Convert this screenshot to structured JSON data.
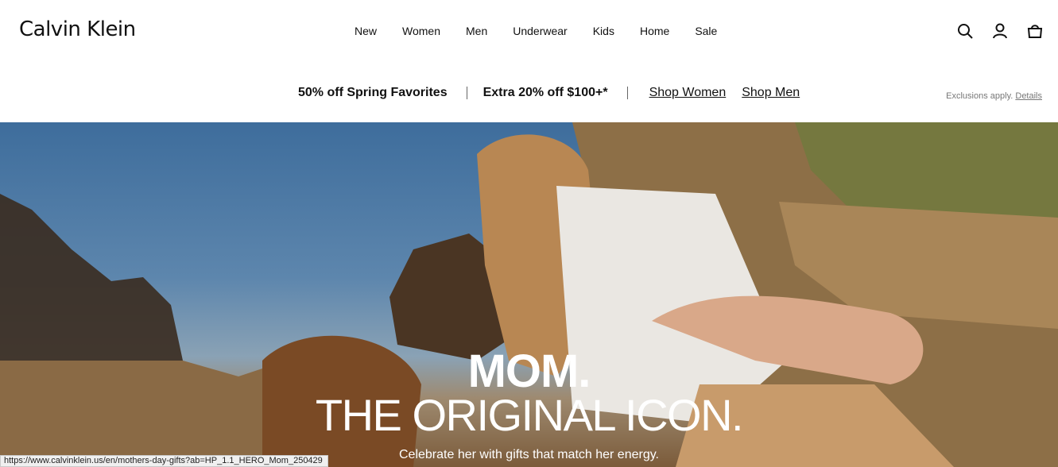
{
  "header": {
    "logo": "Calvin Klein",
    "nav": [
      "New",
      "Women",
      "Men",
      "Underwear",
      "Kids",
      "Home",
      "Sale"
    ]
  },
  "promo": {
    "offer1": "50% off Spring Favorites",
    "offer2": "Extra 20% off $100+*",
    "link_women": "Shop Women",
    "link_men": "Shop Men",
    "exclusions": "Exclusions apply.",
    "details": "Details"
  },
  "hero": {
    "title1": "MOM.",
    "title2": "THE ORIGINAL ICON.",
    "subtitle": "Celebrate her with gifts that match her energy."
  },
  "status_bar": {
    "url": "https://www.calvinklein.us/en/mothers-day-gifts?ab=HP_1.1_HERO_Mom_250429"
  }
}
